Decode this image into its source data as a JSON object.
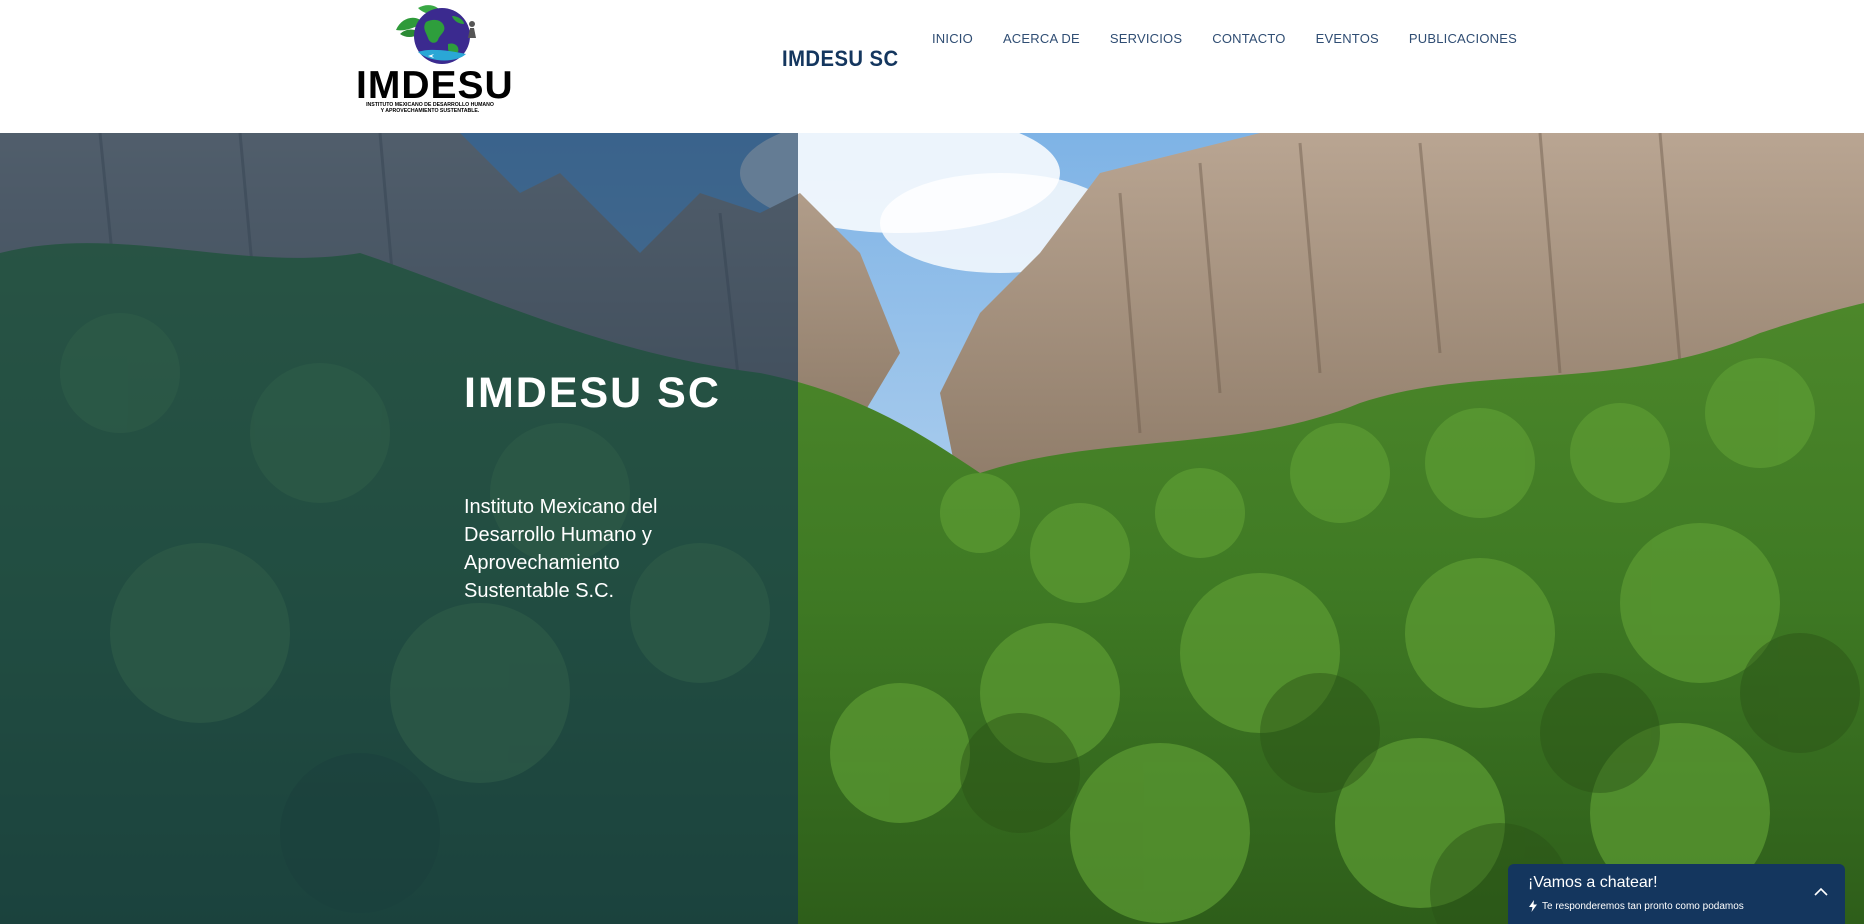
{
  "header": {
    "logo": {
      "icon": "globe-leaves-logo",
      "wordmark": "IMDESU",
      "subtitle_line1": "INSTITUTO MEXICANO DE DESARROLLO HUMANO",
      "subtitle_line2": "Y APROVECHAMIENTO SUSTENTABLE."
    },
    "site_title": "IMDESU SC",
    "nav": {
      "items": [
        {
          "label": "INICIO"
        },
        {
          "label": "ACERCA DE"
        },
        {
          "label": "SERVICIOS"
        },
        {
          "label": "CONTACTO"
        },
        {
          "label": "EVENTOS"
        },
        {
          "label": "PUBLICACIONES"
        }
      ]
    }
  },
  "hero": {
    "title": "IMDESU SC",
    "description": "Instituto Mexicano del Desarrollo Humano y Aprovechamiento Sustentable S.C."
  },
  "chat": {
    "title": "¡Vamos a chatear!",
    "subtitle": "Te responderemos tan pronto como podamos",
    "subtitle_icon": "lightning-icon",
    "toggle_icon": "chevron-up-icon"
  },
  "colors": {
    "brand_navy": "#14365e",
    "nav_text": "#2f4d73",
    "overlay": "#103254"
  }
}
